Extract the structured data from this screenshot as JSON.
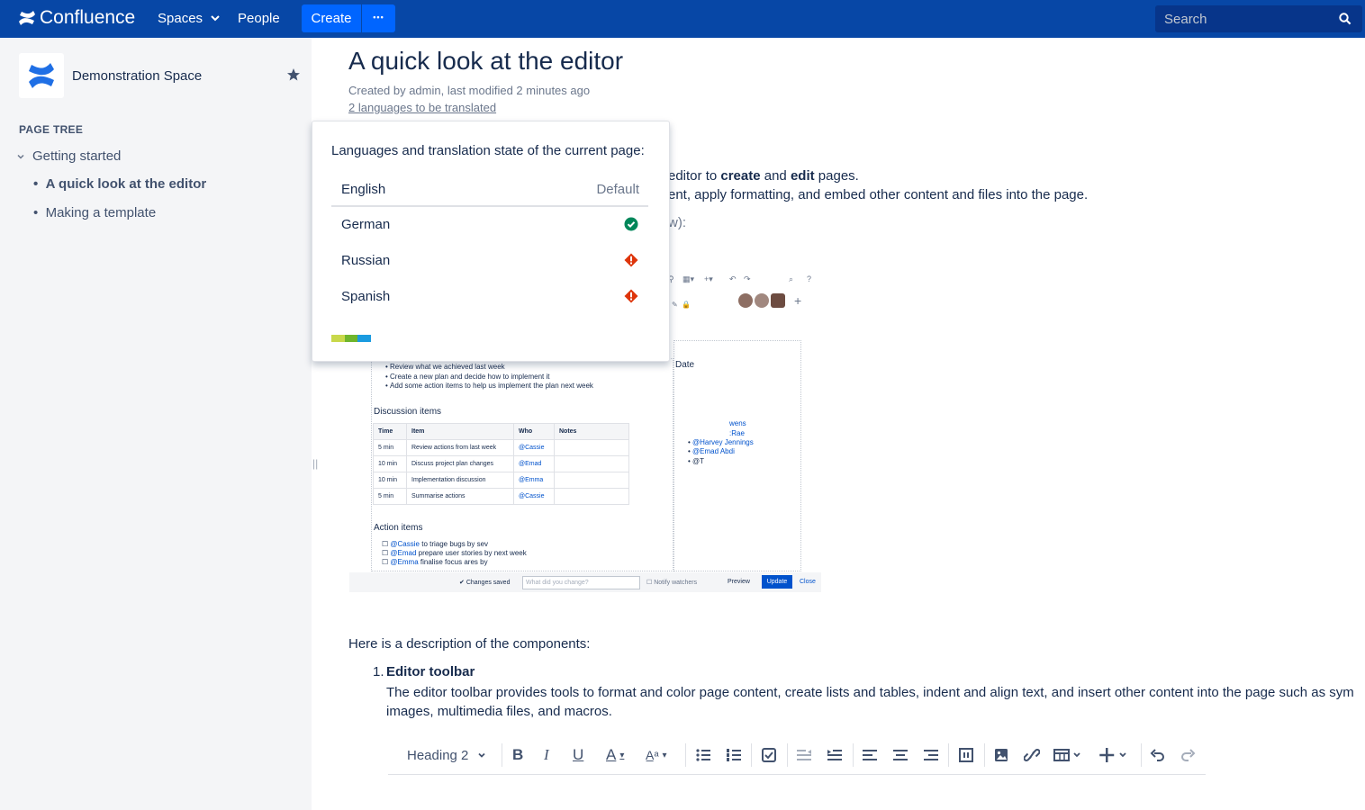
{
  "header": {
    "app_name": "Confluence",
    "spaces_label": "Spaces",
    "people_label": "People",
    "create_label": "Create",
    "more_label": "•••",
    "search_placeholder": "Search"
  },
  "sidebar": {
    "space_name": "Demonstration Space",
    "tree_title": "PAGE TREE",
    "root": "Getting started",
    "children": [
      "A quick look at the editor",
      "Making a template"
    ]
  },
  "page": {
    "title": "A quick look at the editor",
    "meta": "Created by admin, last modified 2 minutes ago",
    "translation_link": "2 languages to be translated",
    "line1_pre": "editor to ",
    "line1_b1": "create",
    "line1_mid": " and ",
    "line1_b2": "edit",
    "line1_post": " pages.",
    "line2": "ent, apply formatting, and embed other content and files into the page.",
    "line3": "w):",
    "components_intro": "Here is a description of the components:",
    "item1_num": "1.",
    "item1_title": "Editor toolbar",
    "item1_desc_1": "The editor toolbar provides tools to format and color page content, create lists and tables, indent and align text, and insert other content into the page such as sym",
    "item1_desc_2": "images, multimedia files, and macros."
  },
  "popup": {
    "heading": "Languages and translation state of the current page:",
    "languages": [
      {
        "name": "English",
        "state": "Default"
      },
      {
        "name": "German",
        "state": "translated"
      },
      {
        "name": "Russian",
        "state": "outdated"
      },
      {
        "name": "Spanish",
        "state": "outdated"
      }
    ]
  },
  "screenshot": {
    "bullets": [
      "Review what we achieved last week",
      "Create a new plan and decide how to implement it",
      "Add some action items to help us implement the plan next week"
    ],
    "date_label": "Date",
    "discussion_title": "Discussion items",
    "table_headers": [
      "Time",
      "Item",
      "Who",
      "Notes"
    ],
    "table_rows": [
      [
        "5 min",
        "Review actions from last week",
        "@Cassie",
        ""
      ],
      [
        "10 min",
        "Discuss project plan changes",
        "@Emad",
        ""
      ],
      [
        "10 min",
        "Implementation discussion",
        "@Emma",
        ""
      ],
      [
        "5 min",
        "Summarise actions",
        "@Cassie",
        ""
      ]
    ],
    "action_title": "Action items",
    "actions": [
      {
        "who": "@Cassie",
        "text": "to triage bugs by sev"
      },
      {
        "who": "@Emad",
        "text": "prepare user stories by next week"
      },
      {
        "who": "@Emma",
        "text": "finalise focus ares by"
      }
    ],
    "right_mentions": [
      "wens",
      ":Rae",
      "@Harvey Jennings",
      "@Emad Abdi",
      "@T"
    ],
    "changes_saved": "Changes saved",
    "change_placeholder": "What did you change?",
    "notify": "Notify watchers",
    "preview": "Preview",
    "update": "Update",
    "close": "Close"
  },
  "toolbar": {
    "style_label": "Heading 2"
  },
  "colors": {
    "header_bg": "#0747a6",
    "create_bg": "#0065ff",
    "success": "#00875a",
    "error": "#de350b"
  }
}
